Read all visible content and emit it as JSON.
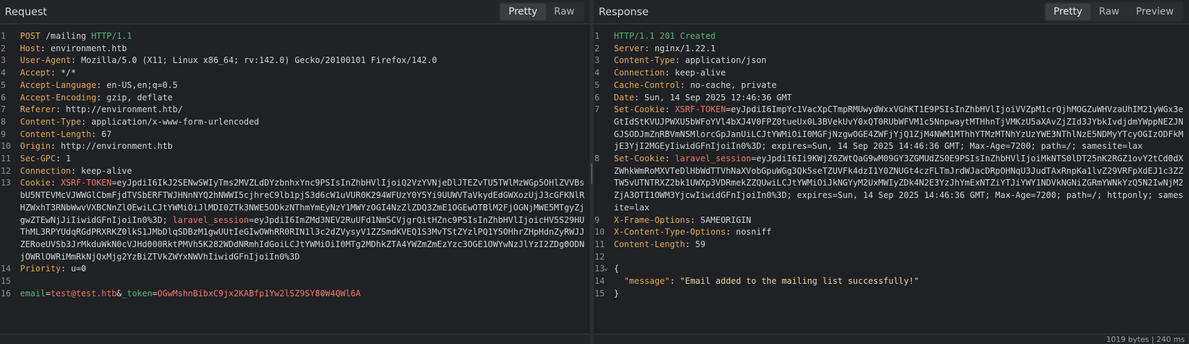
{
  "request": {
    "title": "Request",
    "tabs": [
      "Pretty",
      "Raw"
    ],
    "active_tab": "Pretty",
    "lines": [
      [
        {
          "t": "POST",
          "c": "method"
        },
        {
          "t": " /mailing "
        },
        {
          "t": "HTTP/1.1",
          "c": "ver"
        }
      ],
      [
        {
          "t": "Host",
          "c": "hname"
        },
        {
          "t": ": environment.htb"
        }
      ],
      [
        {
          "t": "User-Agent",
          "c": "hname"
        },
        {
          "t": ": Mozilla/5.0 (X11; Linux x86_64; rv:142.0) Gecko/20100101 Firefox/142.0"
        }
      ],
      [
        {
          "t": "Accept",
          "c": "hname"
        },
        {
          "t": ": */*"
        }
      ],
      [
        {
          "t": "Accept-Language",
          "c": "hname"
        },
        {
          "t": ": en-US,en;q=0.5"
        }
      ],
      [
        {
          "t": "Accept-Encoding",
          "c": "hname"
        },
        {
          "t": ": gzip, deflate"
        }
      ],
      [
        {
          "t": "Referer",
          "c": "hname"
        },
        {
          "t": ": http://environment.htb/"
        }
      ],
      [
        {
          "t": "Content-Type",
          "c": "hname"
        },
        {
          "t": ": application/x-www-form-urlencoded"
        }
      ],
      [
        {
          "t": "Content-Length",
          "c": "hname"
        },
        {
          "t": ": 67"
        }
      ],
      [
        {
          "t": "Origin",
          "c": "hname"
        },
        {
          "t": ": http://environment.htb"
        }
      ],
      [
        {
          "t": "Sec-GPC",
          "c": "hname"
        },
        {
          "t": ": 1"
        }
      ],
      [
        {
          "t": "Connection",
          "c": "hname"
        },
        {
          "t": ": keep-alive"
        }
      ],
      [
        {
          "t": "Cookie",
          "c": "hname"
        },
        {
          "t": ": "
        },
        {
          "t": "XSRF-TOKEN",
          "c": "cname"
        },
        {
          "t": "=eyJpdiI6IkJ2SENwSWIyTms2MVZLdDYzbnhxYnc9PSIsInZhbHVlIjoiQ2VzYVNjeDlJTEZvTU5TWlMzWGp5OHlZVVBsbU5NTEVMcVJWWGlCbmFjdTVSbERFTWJHNnNYQ2hNWWI5cjhreC9lb1pjS3d6cW1uVUR0K294WFUzY0Y5Yi9UUWVTaVkydEdGWXozUjJ3cGFKNlRHZWxhT3RNbWwvVXBCNnZlOEwiLCJtYWMiOiJlMDI0ZTk3NWE5ODkzNThmYmEyNzY1MWYzOGI4NzZlZDQ3ZmE1OGEwOTBlM2FjOGNjMWE5MTgyZjgwZTEwNjJiIiwidGFnIjoiIn0%3D; "
        },
        {
          "t": "laravel_session",
          "c": "cname"
        },
        {
          "t": "=eyJpdiI6ImZMd3NEV2RuUFd1Nm5CVjgrQitHZnc9PSIsInZhbHVlIjoicHV5S29HUThML3RPYUdqRGdPRXRKZ0lkS1JMbDlqSDBzM1gwUUtIeGIwOWhRR0RIN1l3c2dZVysyV1ZZSmdKVEQ1S3MvTStZYzlPQ1Y5OHhrZHpHdnZyRWJJZERoeUVSb3JrMkduWkN0cVJHd000RktPMVh5K282WDdNRmhIdGoiLCJtYWMiOiI0MTg2MDhkZTA4YWZmZmEzYzc3OGE1OWYwNzJlYzI2ZDg0ODNjOWRlOWRiMmRkNjQxMjg2YzBiZTVkZWYxNWVhIiwidGFnIjoiIn0%3D"
        }
      ],
      [
        {
          "t": "Priority",
          "c": "hname"
        },
        {
          "t": ": u=0"
        }
      ],
      [],
      [
        {
          "t": "email",
          "c": "pname"
        },
        {
          "t": "="
        },
        {
          "t": "test@test.htb",
          "c": "pval"
        },
        {
          "t": "&"
        },
        {
          "t": "_token",
          "c": "pname"
        },
        {
          "t": "="
        },
        {
          "t": "OGwMshnBibxC9jx2KABfp1Yw2lSZ9SY80W4QWl6A",
          "c": "pval"
        }
      ]
    ]
  },
  "response": {
    "title": "Response",
    "tabs": [
      "Pretty",
      "Raw",
      "Preview"
    ],
    "active_tab": "Pretty",
    "lines": [
      [
        {
          "t": "HTTP/1.1 201 Created",
          "c": "ver"
        }
      ],
      [
        {
          "t": "Server",
          "c": "hname"
        },
        {
          "t": ": nginx/1.22.1"
        }
      ],
      [
        {
          "t": "Content-Type",
          "c": "hname"
        },
        {
          "t": ": application/json"
        }
      ],
      [
        {
          "t": "Connection",
          "c": "hname"
        },
        {
          "t": ": keep-alive"
        }
      ],
      [
        {
          "t": "Cache-Control",
          "c": "hname"
        },
        {
          "t": ": no-cache, private"
        }
      ],
      [
        {
          "t": "Date",
          "c": "hname"
        },
        {
          "t": ": Sun, 14 Sep 2025 12:46:36 GMT"
        }
      ],
      [
        {
          "t": "Set-Cookie",
          "c": "hname"
        },
        {
          "t": ": "
        },
        {
          "t": "XSRF-TOKEN",
          "c": "cname"
        },
        {
          "t": "=eyJpdiI6ImpYc1VacXpCTmpRMUwydWxxVGhKT1E9PSIsInZhbHVlIjoiVVZpM1crQjhMOGZuWHVzaUhIM21yWGx3eGtIdStKVUJPWXU5bWFoYVl4bXJ4V0FPZ0tueUx0L3BVekUvY0xQT0RUbWFVM1c5NnpwaytMTHhnTjVMKzU5aXAvZjZId3JYbkIvdjdmYWppNEZJNGJSODJmZnRBVmNSMlorcGpJanUiLCJtYWMiOiI0MGFjNzgwOGE4ZWFjYjQ1ZjM4NWM1MThhYTMzMTNhYzUzYWE3NThlNzE5NDMyYTcyOGIzODFkMjE3YjI2MGEyIiwidGFnIjoiIn0%3D; expires=Sun, 14 Sep 2025 14:46:36 GMT; Max-Age=7200; path=/; samesite=lax"
        }
      ],
      [
        {
          "t": "Set-Cookie",
          "c": "hname"
        },
        {
          "t": ": "
        },
        {
          "t": "laravel_session",
          "c": "cname"
        },
        {
          "t": "=eyJpdiI6Ii9KWjZ6ZWtQaG9wM09GY3ZGMUdZS0E9PSIsInZhbHVlIjoiMkNTS0lDT25nK2RGZ1ovY2tCd0dXZWhkWmRoMXVTeDlHbWdTTVhNaXVobGpuWGg3Qk5seTZUVFk4dzI1Y0ZNUGt4czFLTmJrdWJacDRpOHNqU3JudTAxRnpKa1lvZ29VRFpXdEJ1c3ZZTW5vUTNTRXZ2bk1UWXp3VDRmekZZQUwiLCJtYWMiOiJkNGYyM2UxMWIyZDk4N2E3YzJhYmExNTZiYTJiYWY1NDVkNGNiZGRmYWNkYzQ5N2IwNjM2ZjA3OTI1OWM3YjcwIiwidGFnIjoiIn0%3D; expires=Sun, 14 Sep 2025 14:46:36 GMT; Max-Age=7200; path=/; httponly; samesite=lax"
        }
      ],
      [
        {
          "t": "X-Frame-Options",
          "c": "hname"
        },
        {
          "t": ": SAMEORIGIN"
        }
      ],
      [
        {
          "t": "X-Content-Type-Options",
          "c": "hname"
        },
        {
          "t": ": nosniff"
        }
      ],
      [
        {
          "t": "Content-Length",
          "c": "hname"
        },
        {
          "t": ": 59"
        }
      ],
      [],
      [
        {
          "t": "{"
        }
      ],
      [
        {
          "t": "  "
        },
        {
          "t": "\"message\"",
          "c": "jkey"
        },
        {
          "t": ": "
        },
        {
          "t": "\"Email added to the mailing list successfully!\"",
          "c": "jstr"
        }
      ],
      [
        {
          "t": "}"
        }
      ]
    ],
    "fold_markers": {
      "13": "chevron-down-icon"
    },
    "status_partial": "1019 bytes | 240 ms"
  }
}
